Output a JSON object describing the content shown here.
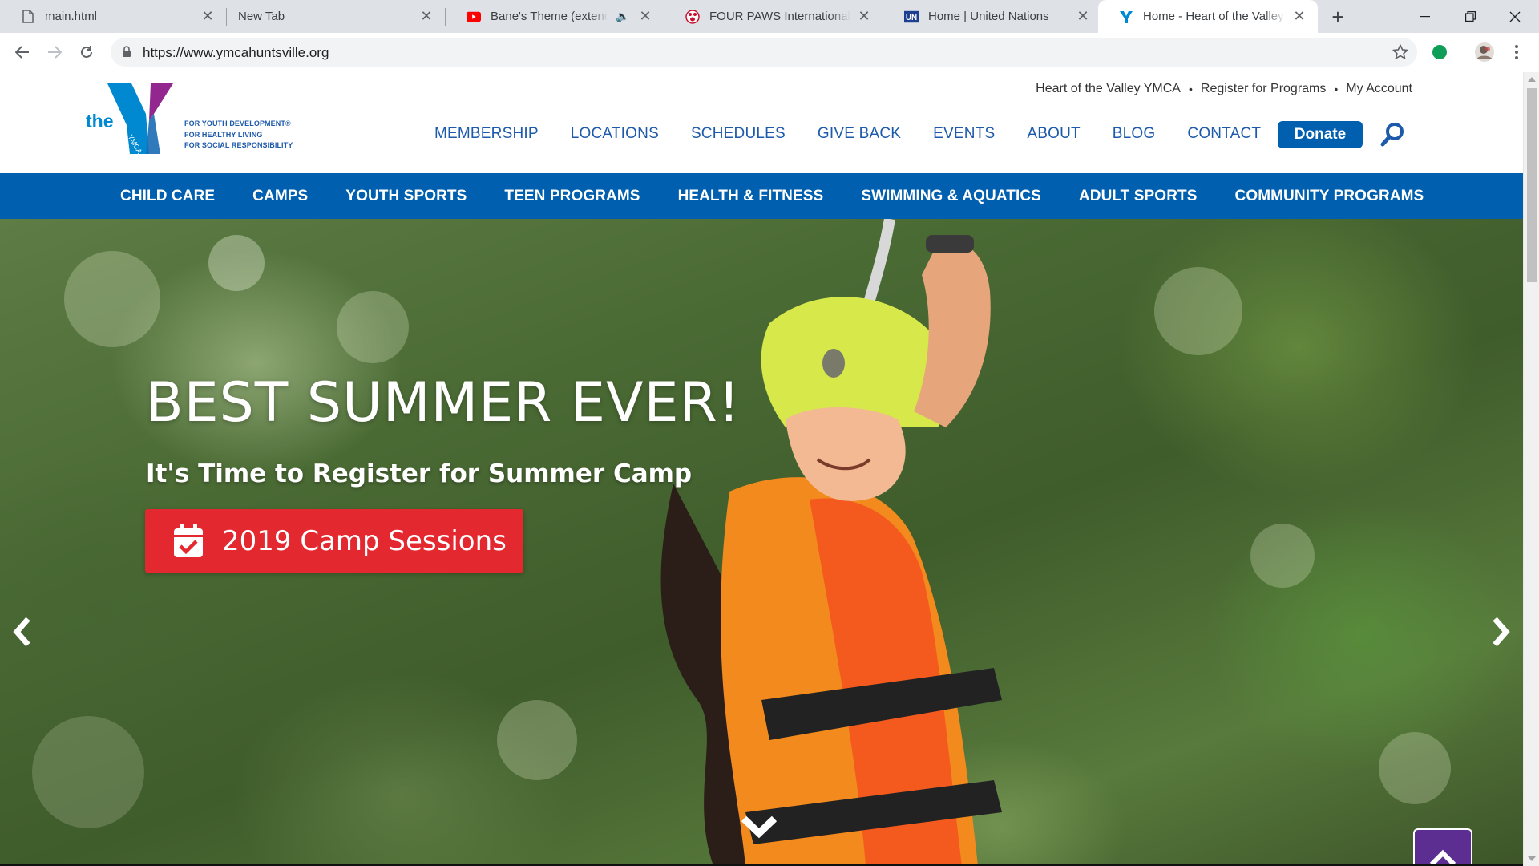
{
  "browser": {
    "tabs": [
      {
        "title": "main.html",
        "icon": "file-icon"
      },
      {
        "title": "New Tab",
        "icon": "none"
      },
      {
        "title": "Bane's Theme (extended",
        "icon": "youtube-icon",
        "audio": true
      },
      {
        "title": "FOUR PAWS International",
        "icon": "four-paws-icon"
      },
      {
        "title": "Home | United Nations",
        "icon": "un-icon"
      },
      {
        "title": "Home - Heart of the Valley Y",
        "icon": "ymca-icon",
        "active": true
      }
    ],
    "url": "https://www.ymcahuntsville.org"
  },
  "site": {
    "logo": {
      "the": "the",
      "tagline": [
        "FOR YOUTH DEVELOPMENT®",
        "FOR HEALTHY LIVING",
        "FOR SOCIAL RESPONSIBILITY"
      ]
    },
    "utility_nav": [
      "Heart of the Valley YMCA",
      "Register for Programs",
      "My Account"
    ],
    "utility_sep": "•",
    "main_nav": [
      "MEMBERSHIP",
      "LOCATIONS",
      "SCHEDULES",
      "GIVE BACK",
      "EVENTS",
      "ABOUT",
      "BLOG",
      "CONTACT"
    ],
    "donate_label": "Donate",
    "program_nav": [
      "CHILD CARE",
      "CAMPS",
      "YOUTH SPORTS",
      "TEEN PROGRAMS",
      "HEALTH & FITNESS",
      "SWIMMING & AQUATICS",
      "ADULT SPORTS",
      "COMMUNITY PROGRAMS"
    ]
  },
  "hero": {
    "title": "BEST SUMMER EVER!",
    "subtitle": "It's Time to Register for Summer Camp",
    "cta_label": "2019 Camp Sessions"
  },
  "colors": {
    "ymca_blue": "#0060af",
    "ymca_purple": "#92278f",
    "cta_red": "#e4282f",
    "back_to_top_purple": "#5c2e91"
  }
}
